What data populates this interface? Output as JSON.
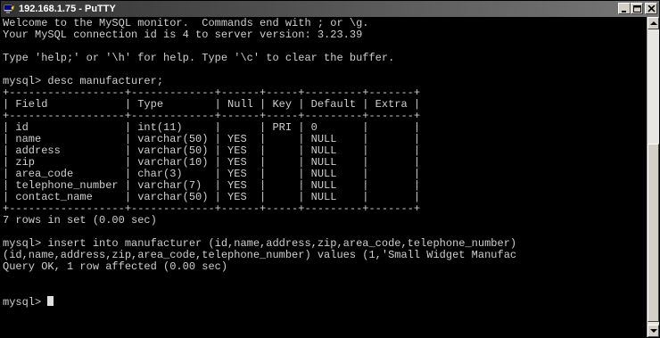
{
  "window": {
    "title": "192.168.1.75 - PuTTY",
    "icon": "putty-terminal-icon"
  },
  "title_buttons": {
    "minimize": "minimize-icon",
    "maximize": "maximize-icon",
    "close": "close-icon"
  },
  "terminal": {
    "lines": [
      "Welcome to the MySQL monitor.  Commands end with ; or \\g.",
      "Your MySQL connection id is 4 to server version: 3.23.39",
      "",
      "Type 'help;' or '\\h' for help. Type '\\c' to clear the buffer.",
      "",
      "mysql> desc manufacturer;",
      "+------------------+-------------+------+-----+---------+-------+",
      "| Field            | Type        | Null | Key | Default | Extra |",
      "+------------------+-------------+------+-----+---------+-------+",
      "| id               | int(11)     |      | PRI | 0       |       |",
      "| name             | varchar(50) | YES  |     | NULL    |       |",
      "| address          | varchar(50) | YES  |     | NULL    |       |",
      "| zip              | varchar(10) | YES  |     | NULL    |       |",
      "| area_code        | char(3)     | YES  |     | NULL    |       |",
      "| telephone_number | varchar(7)  | YES  |     | NULL    |       |",
      "| contact_name     | varchar(50) | YES  |     | NULL    |       |",
      "+------------------+-------------+------+-----+---------+-------+",
      "7 rows in set (0.00 sec)",
      "",
      "mysql> insert into manufacturer (id,name,address,zip,area_code,telephone_number)",
      "(id,name,address,zip,area_code,telephone_number) values (1,'Small Widget Manufac",
      "Query OK, 1 row affected (0.00 sec)",
      "",
      "",
      "mysql> "
    ]
  }
}
